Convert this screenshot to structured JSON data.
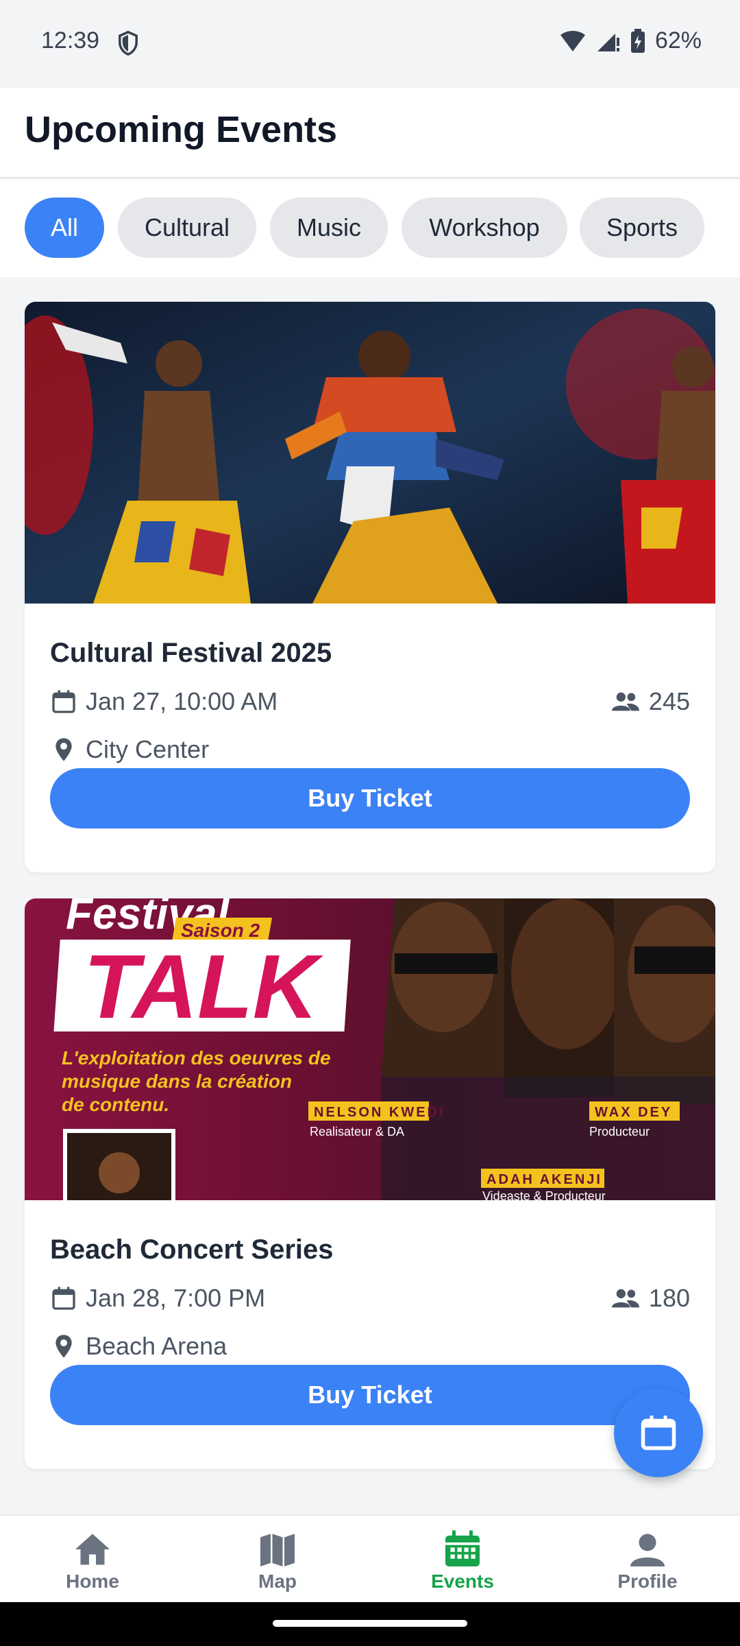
{
  "status": {
    "time": "12:39",
    "battery": "62%"
  },
  "header": {
    "title": "Upcoming Events"
  },
  "filters": [
    {
      "label": "All",
      "active": true
    },
    {
      "label": "Cultural"
    },
    {
      "label": "Music"
    },
    {
      "label": "Workshop"
    },
    {
      "label": "Sports"
    }
  ],
  "events": [
    {
      "title": "Cultural Festival 2025",
      "date": "Jan 27, 10:00 AM",
      "attendees": "245",
      "location": "City Center",
      "button": "Buy Ticket"
    },
    {
      "title": "Beach Concert Series",
      "date": "Jan 28, 7:00 PM",
      "attendees": "180",
      "location": "Beach Arena",
      "button": "Buy Ticket",
      "poster": {
        "headline": "Festival",
        "season": "Saison 2",
        "talk": "TALK",
        "subtitle": "L'exploitation des oeuvres de musique dans la création de contenu.",
        "names": [
          {
            "name": "NELSON KWEDI",
            "role": "Realisateur & DA"
          },
          {
            "name": "WAX DEY",
            "role": "Producteur"
          },
          {
            "name": "ADAH AKENJI",
            "role": "Videaste & Producteur"
          }
        ]
      }
    }
  ],
  "nav": [
    {
      "label": "Home",
      "icon": "home-icon"
    },
    {
      "label": "Map",
      "icon": "map-icon"
    },
    {
      "label": "Events",
      "icon": "calendar-icon",
      "active": true
    },
    {
      "label": "Profile",
      "icon": "profile-icon"
    }
  ],
  "colors": {
    "accent": "#3b82f6",
    "active_nav": "#16a34a"
  }
}
